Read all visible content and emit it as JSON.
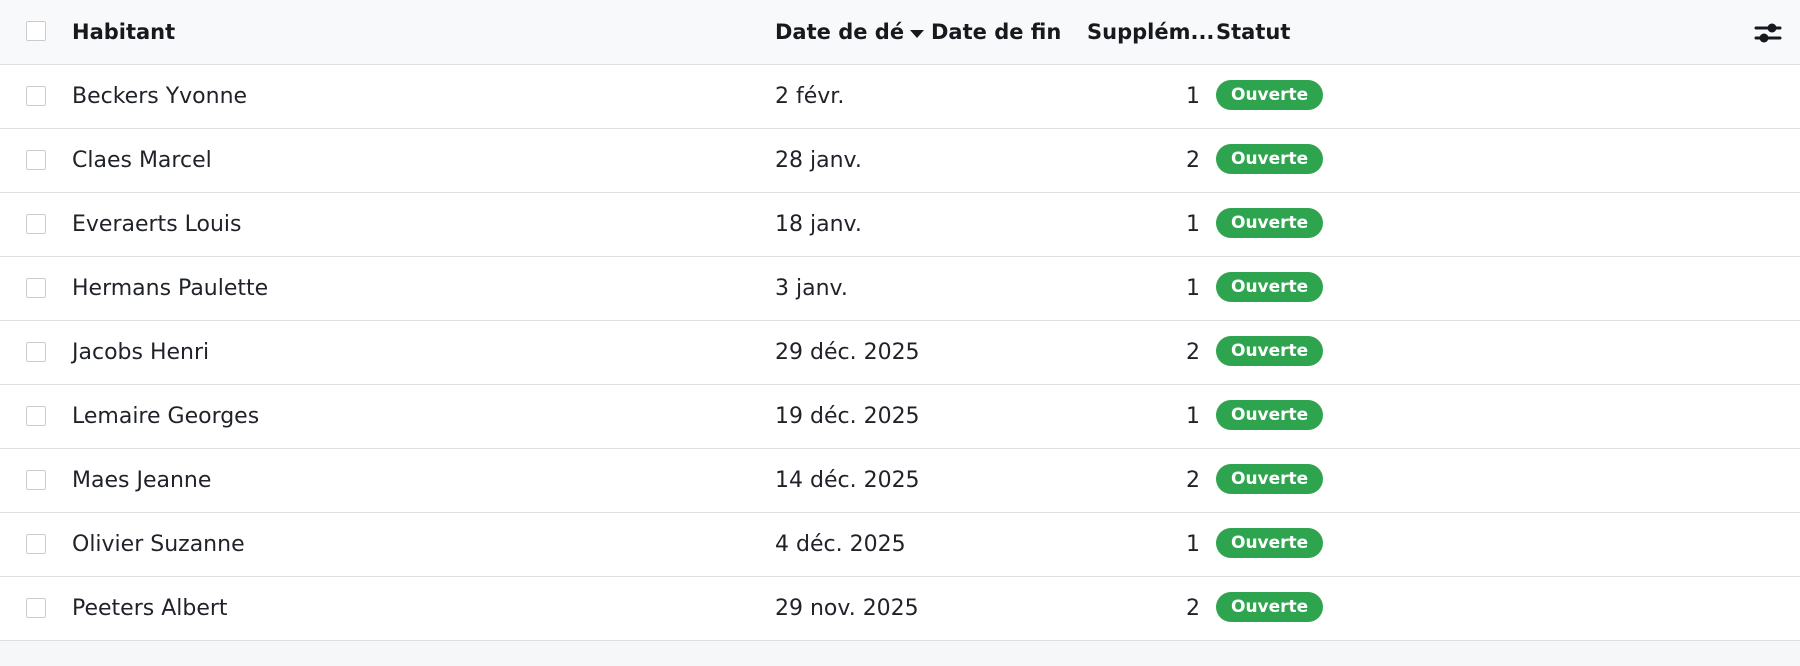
{
  "table": {
    "columns": {
      "habitant": "Habitant",
      "date_debut": "Date de dé",
      "date_fin": "Date de fin",
      "supplements": "Supplém...",
      "statut": "Statut"
    },
    "sort": {
      "column": "date_debut",
      "direction": "desc"
    },
    "settings_icon": "sliders-icon",
    "status_color": "#2ea44f",
    "rows": [
      {
        "habitant": "Beckers Yvonne",
        "date_debut": "2 févr.",
        "date_fin": "",
        "supplements": "1",
        "statut": "Ouverte"
      },
      {
        "habitant": "Claes Marcel",
        "date_debut": "28 janv.",
        "date_fin": "",
        "supplements": "2",
        "statut": "Ouverte"
      },
      {
        "habitant": "Everaerts Louis",
        "date_debut": "18 janv.",
        "date_fin": "",
        "supplements": "1",
        "statut": "Ouverte"
      },
      {
        "habitant": "Hermans Paulette",
        "date_debut": "3 janv.",
        "date_fin": "",
        "supplements": "1",
        "statut": "Ouverte"
      },
      {
        "habitant": "Jacobs Henri",
        "date_debut": "29 déc. 2025",
        "date_fin": "",
        "supplements": "2",
        "statut": "Ouverte"
      },
      {
        "habitant": "Lemaire Georges",
        "date_debut": "19 déc. 2025",
        "date_fin": "",
        "supplements": "1",
        "statut": "Ouverte"
      },
      {
        "habitant": "Maes Jeanne",
        "date_debut": "14 déc. 2025",
        "date_fin": "",
        "supplements": "2",
        "statut": "Ouverte"
      },
      {
        "habitant": "Olivier Suzanne",
        "date_debut": "4 déc. 2025",
        "date_fin": "",
        "supplements": "1",
        "statut": "Ouverte"
      },
      {
        "habitant": "Peeters Albert",
        "date_debut": "29 nov. 2025",
        "date_fin": "",
        "supplements": "2",
        "statut": "Ouverte"
      }
    ]
  }
}
